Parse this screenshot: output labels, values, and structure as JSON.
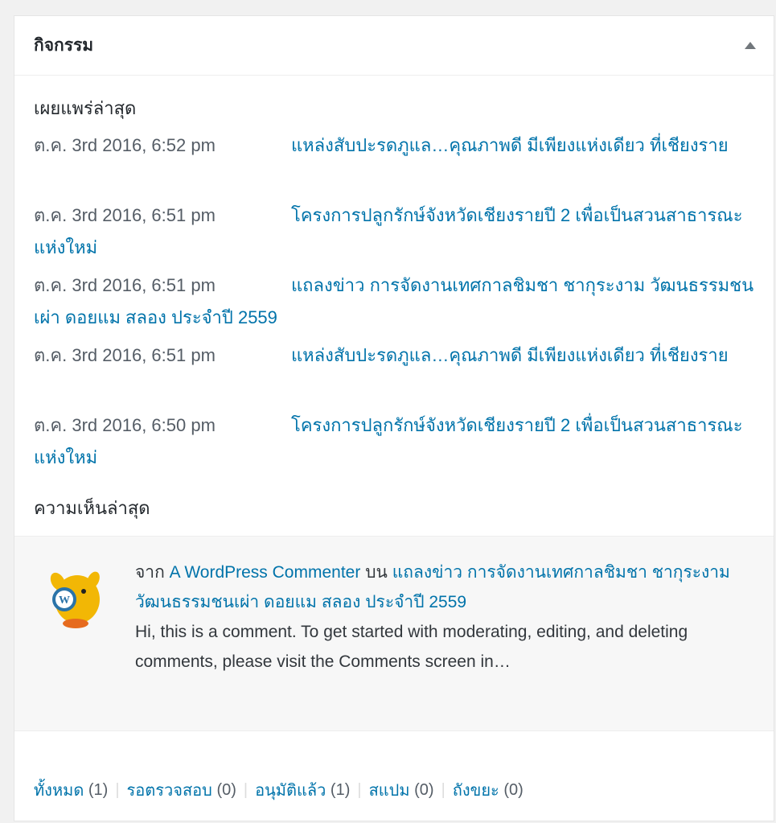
{
  "panel": {
    "title": "กิจกรรม"
  },
  "published": {
    "heading": "เผยแพร่ล่าสุด",
    "items": [
      {
        "date": "ต.ค. 3rd 2016, 6:52 pm",
        "title": "แหล่งสับปะรดภูแล…คุณภาพดี มีเพียงแห่งเดียว ที่เชียงราย"
      },
      {
        "date": "ต.ค. 3rd 2016, 6:51 pm",
        "title": "โครงการปลูกรักษ์จังหวัดเชียงรายปี 2 เพื่อเป็นสวนสาธารณะแห่งใหม่"
      },
      {
        "date": "ต.ค. 3rd 2016, 6:51 pm",
        "title": "แถลงข่าว การจัดงานเทศกาลชิมชา ชากุระงาม วัฒนธรรมชนเผ่า ดอยแม สลอง ประจำปี 2559"
      },
      {
        "date": "ต.ค. 3rd 2016, 6:51 pm",
        "title": "แหล่งสับปะรดภูแล…คุณภาพดี มีเพียงแห่งเดียว ที่เชียงราย"
      },
      {
        "date": "ต.ค. 3rd 2016, 6:50 pm",
        "title": "โครงการปลูกรักษ์จังหวัดเชียงรายปี 2 เพื่อเป็นสวนสาธารณะแห่งใหม่"
      }
    ]
  },
  "comments": {
    "heading": "ความเห็นล่าสุด",
    "item": {
      "from_label": "จาก",
      "author": "A WordPress Commenter",
      "on_label": "บน",
      "post_title": "แถลงข่าว การจัดงานเทศกาลชิมชา ชากุระงาม วัฒนธรรมชนเผ่า ดอยแม สลอง ประจำปี 2559",
      "excerpt": "Hi, this is a comment. To get started with moderating, editing, and deleting comments, please visit the Comments screen in…"
    }
  },
  "filters": [
    {
      "label": "ทั้งหมด",
      "count": "(1)"
    },
    {
      "label": "รอตรวจสอบ",
      "count": "(0)"
    },
    {
      "label": "อนุมัติแล้ว",
      "count": "(1)"
    },
    {
      "label": "สแปม",
      "count": "(0)"
    },
    {
      "label": "ถังขยะ",
      "count": "(0)"
    }
  ],
  "colors": {
    "link": "#0073aa",
    "meta": "#555d66",
    "background": "#f1f1f1"
  }
}
